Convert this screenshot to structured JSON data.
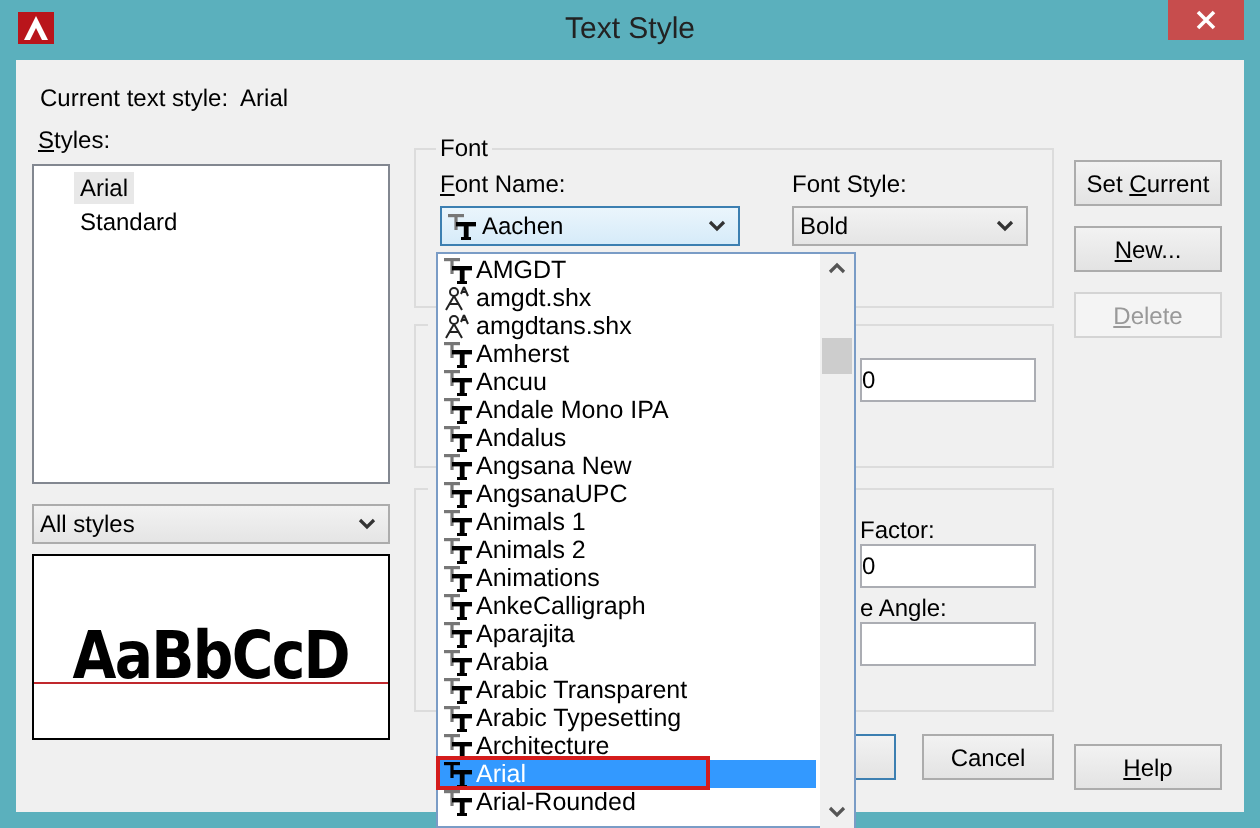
{
  "window": {
    "title": "Text Style"
  },
  "current_style": {
    "label": "Current text style:",
    "value": "Arial"
  },
  "styles": {
    "label": [
      {
        "text": "S",
        "underline": true
      },
      {
        "text": "tyles:",
        "underline": false
      }
    ],
    "items": [
      {
        "name": "Arial",
        "selected": true
      },
      {
        "name": "Standard",
        "selected": false
      }
    ],
    "filter": "All styles"
  },
  "preview": {
    "text": "AaBbCcD"
  },
  "font": {
    "title": "Font",
    "font_name": {
      "label": [
        {
          "text": "F",
          "underline": true
        },
        {
          "text": "ont Name:",
          "underline": false
        }
      ],
      "value": "Aachen"
    },
    "font_style": {
      "label": [
        {
          "text": "Font Style:",
          "underline": false
        }
      ],
      "value": "Bold"
    }
  },
  "size": {
    "value": "0"
  },
  "effects": {
    "fields": [
      {
        "label": "Factor:",
        "value": "0"
      },
      {
        "label": "e Angle:"
      }
    ]
  },
  "side_buttons": [
    {
      "label": [
        {
          "text": "Set ",
          "underline": false
        },
        {
          "text": "C",
          "underline": true
        },
        {
          "text": "urrent",
          "underline": false
        }
      ],
      "disabled": false
    },
    {
      "label": [
        {
          "text": "N",
          "underline": true
        },
        {
          "text": "ew...",
          "underline": false
        }
      ],
      "disabled": false
    },
    {
      "label": [
        {
          "text": "D",
          "underline": true
        },
        {
          "text": "elete",
          "underline": false
        }
      ],
      "disabled": true
    }
  ],
  "bottom_buttons": [
    {
      "default": true
    },
    {
      "label": [
        {
          "text": "Cancel",
          "underline": false
        }
      ],
      "default": false
    },
    {
      "label": [
        {
          "text": "H",
          "underline": true
        },
        {
          "text": "elp",
          "underline": false
        }
      ],
      "default": false
    }
  ],
  "font_list": [
    {
      "name": "AMGDT",
      "kind": "truetype",
      "selected": false
    },
    {
      "name": "amgdt.shx",
      "kind": "shx",
      "selected": false
    },
    {
      "name": "amgdtans.shx",
      "kind": "shx",
      "selected": false
    },
    {
      "name": "Amherst",
      "kind": "truetype",
      "selected": false
    },
    {
      "name": "Ancuu",
      "kind": "truetype",
      "selected": false
    },
    {
      "name": "Andale Mono IPA",
      "kind": "truetype",
      "selected": false
    },
    {
      "name": "Andalus",
      "kind": "truetype",
      "selected": false
    },
    {
      "name": "Angsana New",
      "kind": "truetype",
      "selected": false
    },
    {
      "name": "AngsanaUPC",
      "kind": "truetype",
      "selected": false
    },
    {
      "name": "Animals 1",
      "kind": "truetype",
      "selected": false
    },
    {
      "name": "Animals 2",
      "kind": "truetype",
      "selected": false
    },
    {
      "name": "Animations",
      "kind": "truetype",
      "selected": false
    },
    {
      "name": "AnkeCalligraph",
      "kind": "truetype",
      "selected": false
    },
    {
      "name": "Aparajita",
      "kind": "truetype",
      "selected": false
    },
    {
      "name": "Arabia",
      "kind": "truetype",
      "selected": false
    },
    {
      "name": "Arabic Transparent",
      "kind": "truetype",
      "selected": false
    },
    {
      "name": "Arabic Typesetting",
      "kind": "truetype",
      "selected": false
    },
    {
      "name": "Architecture",
      "kind": "truetype",
      "selected": false
    },
    {
      "name": "Arial",
      "kind": "truetype",
      "selected": true
    },
    {
      "name": "Arial-Rounded",
      "kind": "truetype",
      "selected": false
    }
  ],
  "highlight": {
    "around_selected": true
  }
}
